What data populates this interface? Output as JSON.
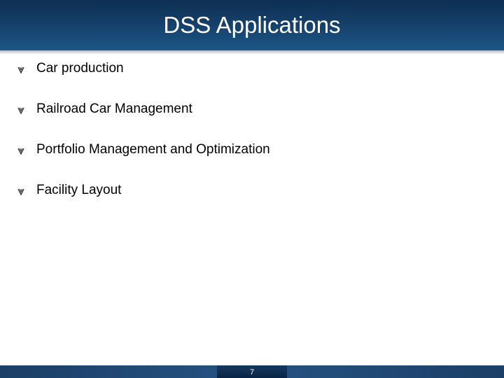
{
  "slide": {
    "title": "DSS Applications",
    "bullets": [
      {
        "text": "Car production",
        "icon": "diamond-bullet-icon"
      },
      {
        "text": "Railroad Car Management",
        "icon": "diamond-bullet-icon"
      },
      {
        "text": "Portfolio Management and Optimization",
        "icon": "diamond-bullet-icon"
      },
      {
        "text": "Facility Layout",
        "icon": "diamond-bullet-icon"
      }
    ],
    "page_number": "7"
  },
  "colors": {
    "title_bar": "#153f68",
    "footer_bar": "#0f2e52",
    "title_text": "#ffffff",
    "body_text": "#000000"
  }
}
